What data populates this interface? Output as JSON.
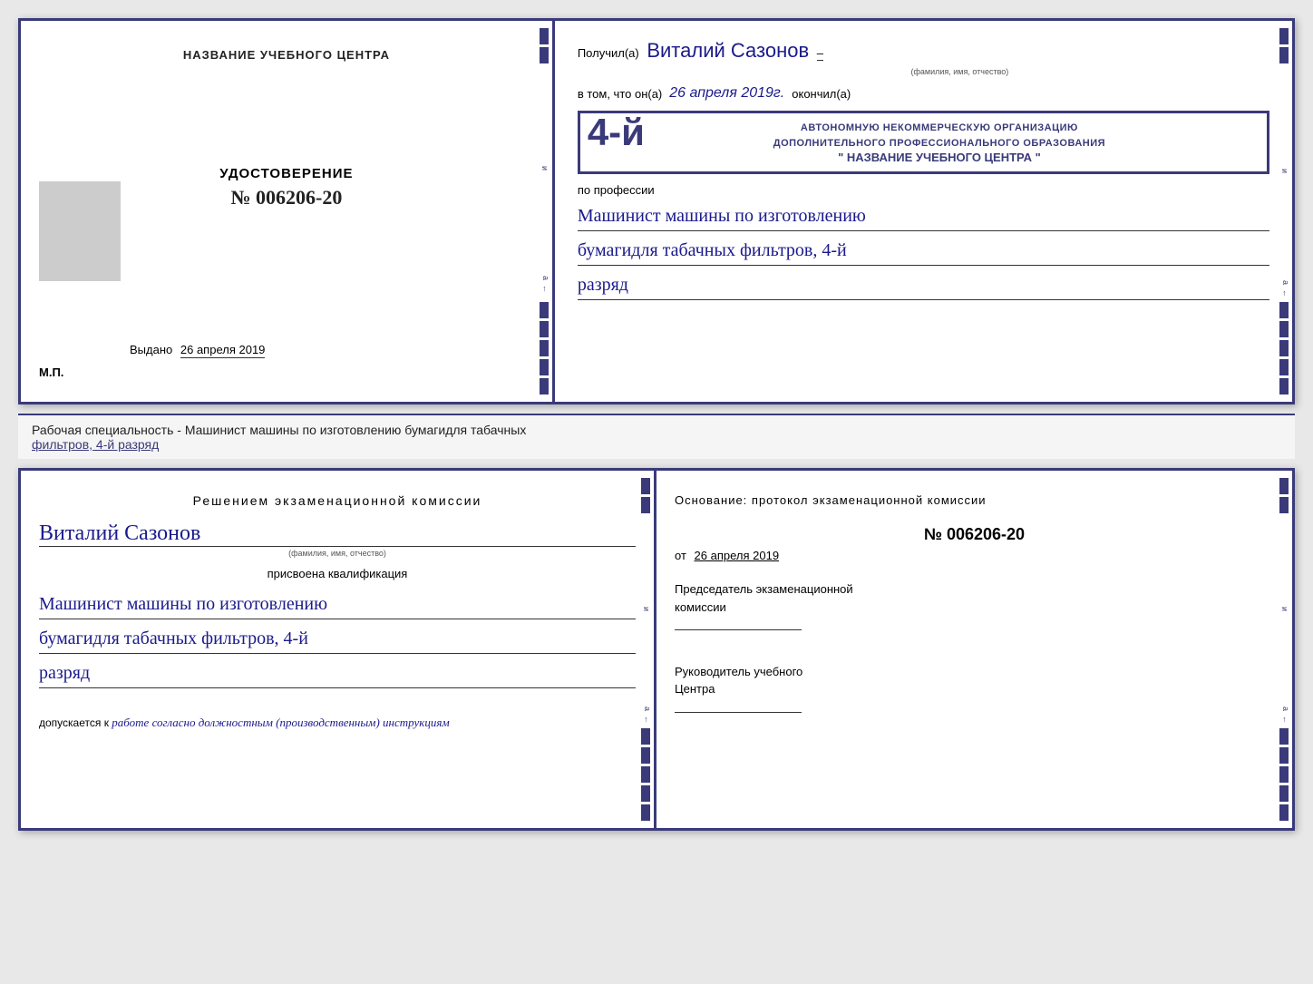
{
  "top_cert": {
    "left": {
      "title": "НАЗВАНИЕ УЧЕБНОГО ЦЕНТРА",
      "udostoverenie": "УДОСТОВЕРЕНИЕ",
      "number": "№ 006206-20",
      "vydano_label": "Выдано",
      "vydano_date": "26 апреля 2019",
      "mp": "М.П."
    },
    "right": {
      "poluchil_prefix": "Получил(а)",
      "fio": "Виталий Сазонов",
      "fio_subtitle": "(фамилия, имя, отчество)",
      "vtom_prefix": "в том, что он(а)",
      "vtom_date": "26 апреля 2019г.",
      "okonchil": "окончил(а)",
      "stamp_line1": "4-й",
      "stamp_line2": "АВТОНОМНУЮ НЕКОММЕРЧЕСКУЮ ОРГАНИЗАЦИЮ",
      "stamp_line3": "ДОПОЛНИТЕЛЬНОГО ПРОФЕССИОНАЛЬНОГО ОБРАЗОВАНИЯ",
      "stamp_line4": "\" НАЗВАНИЕ УЧЕБНОГО ЦЕНТРА \"",
      "po_professii": "по профессии",
      "profession1": "Машинист машины по изготовлению",
      "profession2": "бумагидля табачных фильтров, 4-й",
      "profession3": "разряд"
    }
  },
  "specialty_bar": {
    "text": "Рабочая специальность - Машинист машины по изготовлению бумагидля табачных",
    "text2": "фильтров, 4-й разряд"
  },
  "bottom_cert": {
    "left": {
      "resheniem": "Решением  экзаменационной  комиссии",
      "fio": "Виталий Сазонов",
      "fio_subtitle": "(фамилия, имя, отчество)",
      "prisvoena": "присвоена квалификация",
      "qualification1": "Машинист машины по изготовлению",
      "qualification2": "бумагидля табачных фильтров, 4-й",
      "qualification3": "разряд",
      "dopusk_prefix": "допускается к",
      "dopusk_text": "работе согласно должностным (производственным) инструкциям"
    },
    "right": {
      "osnovanie": "Основание:  протокол  экзаменационной  комиссии",
      "number": "№  006206-20",
      "ot_prefix": "от",
      "ot_date": "26 апреля 2019",
      "chairman1": "Председатель экзаменационной",
      "chairman2": "комиссии",
      "rukovoditel1": "Руководитель учебного",
      "rukovoditel2": "Центра"
    }
  }
}
